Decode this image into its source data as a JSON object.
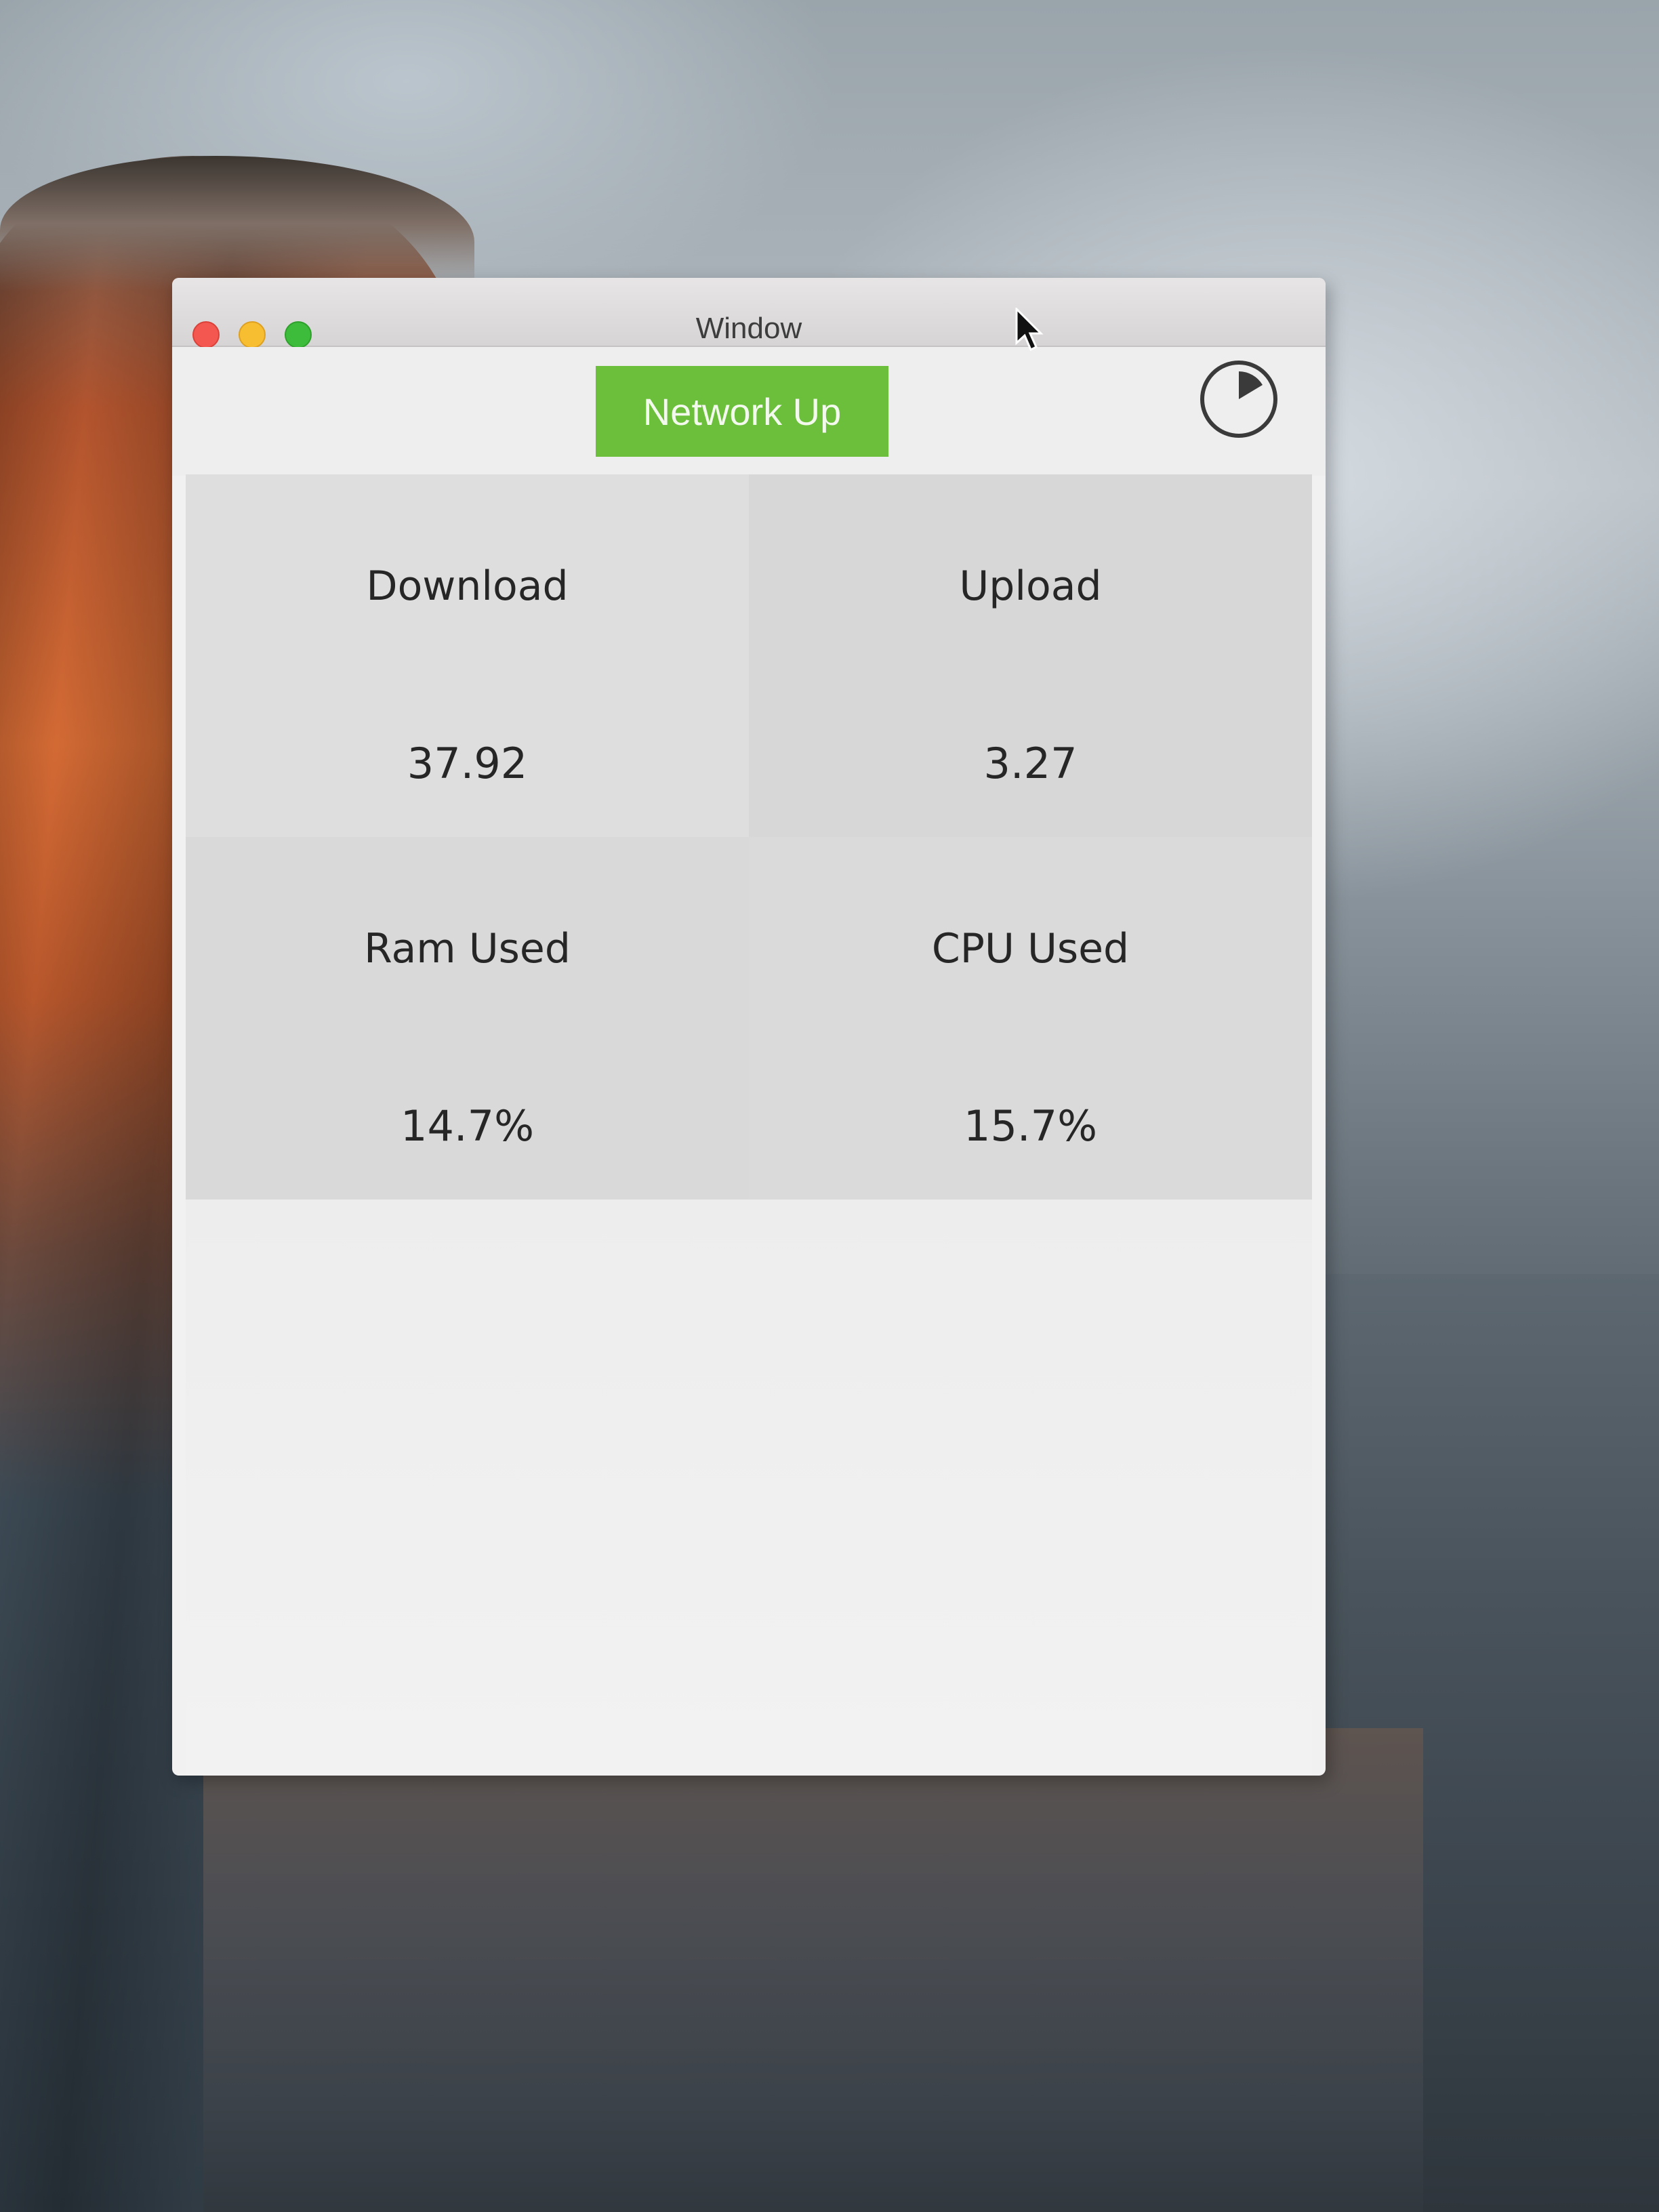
{
  "window": {
    "title": "Window"
  },
  "toolbar": {
    "status_label": "Network Up",
    "status_color": "#6bbf3b",
    "timer_icon": "timer-icon"
  },
  "stats": {
    "download": {
      "label": "Download",
      "value": "37.92"
    },
    "upload": {
      "label": "Upload",
      "value": "3.27"
    },
    "ram": {
      "label": "Ram Used",
      "value": "14.7%"
    },
    "cpu": {
      "label": "CPU Used",
      "value": "15.7%"
    }
  },
  "traffic_lights": {
    "close_color": "#f3574f",
    "minimize_color": "#f8be32",
    "zoom_color": "#3cbc3a"
  }
}
